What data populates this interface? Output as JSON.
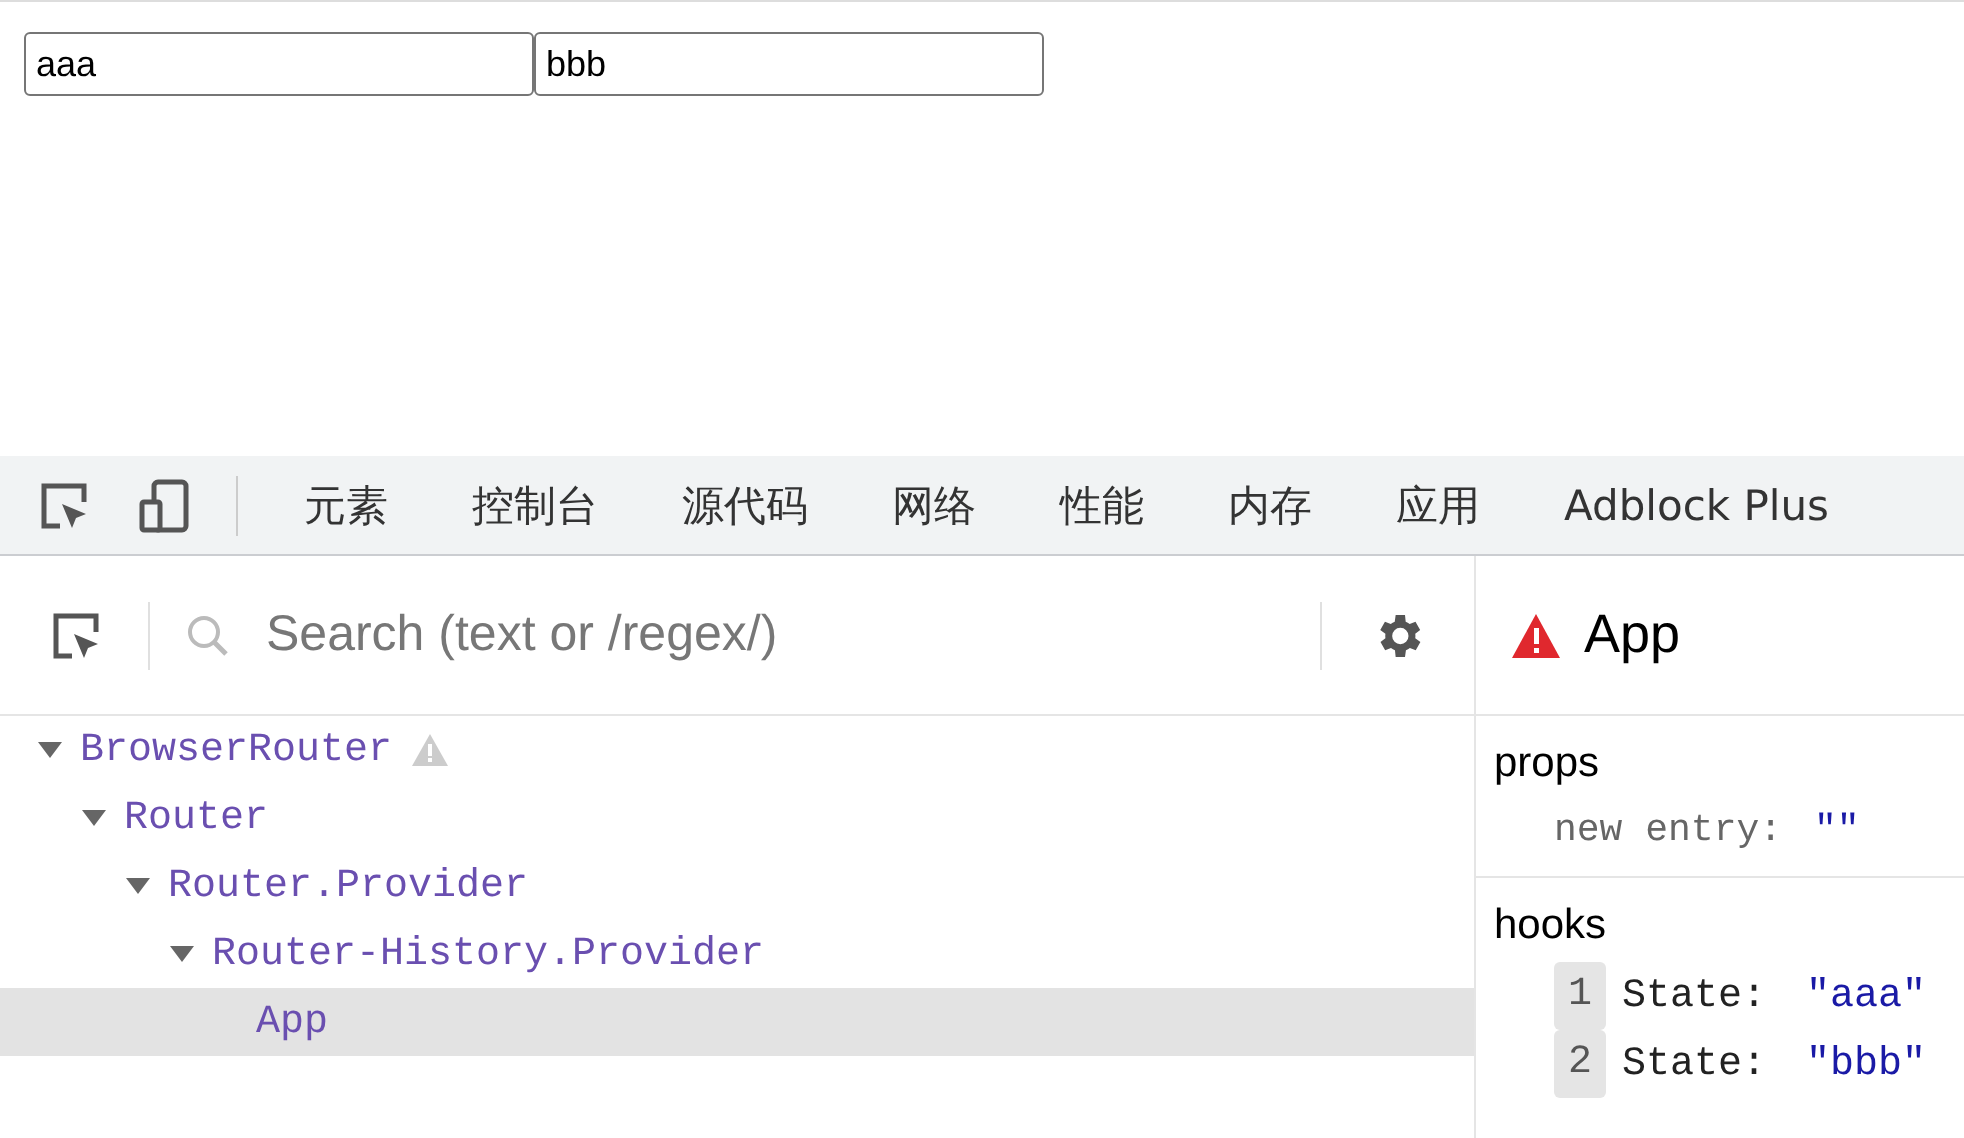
{
  "page": {
    "inputs": [
      {
        "value": "aaa"
      },
      {
        "value": "bbb"
      }
    ]
  },
  "devtools": {
    "tabs": [
      {
        "label": "元素",
        "selected": false
      },
      {
        "label": "控制台",
        "selected": false
      },
      {
        "label": "源代码",
        "selected": false
      },
      {
        "label": "网络",
        "selected": false
      },
      {
        "label": "性能",
        "selected": false
      },
      {
        "label": "内存",
        "selected": false
      },
      {
        "label": "应用",
        "selected": false
      },
      {
        "label": "Adblock Plus",
        "selected": false
      }
    ]
  },
  "components": {
    "search": {
      "placeholder": "Search (text or /regex/)"
    },
    "tree": [
      {
        "name": "BrowserRouter",
        "warning": true,
        "expanded": true,
        "selected": false,
        "children": [
          {
            "name": "Router",
            "warning": false,
            "expanded": true,
            "selected": false,
            "children": [
              {
                "name": "Router.Provider",
                "warning": false,
                "expanded": true,
                "selected": false,
                "children": [
                  {
                    "name": "Router-History.Provider",
                    "warning": false,
                    "expanded": true,
                    "selected": false,
                    "children": [
                      {
                        "name": "App",
                        "warning": false,
                        "expanded": false,
                        "selected": true
                      }
                    ]
                  }
                ]
              }
            ]
          }
        ]
      }
    ]
  },
  "inspector": {
    "title": "App",
    "props": {
      "heading": "props",
      "items": [
        {
          "key": "new entry:",
          "value": "\"\""
        }
      ]
    },
    "hooks": {
      "heading": "hooks",
      "items": [
        {
          "index": "1",
          "name": "State:",
          "value": "\"aaa\""
        },
        {
          "index": "2",
          "name": "State:",
          "value": "\"bbb\""
        }
      ]
    }
  }
}
